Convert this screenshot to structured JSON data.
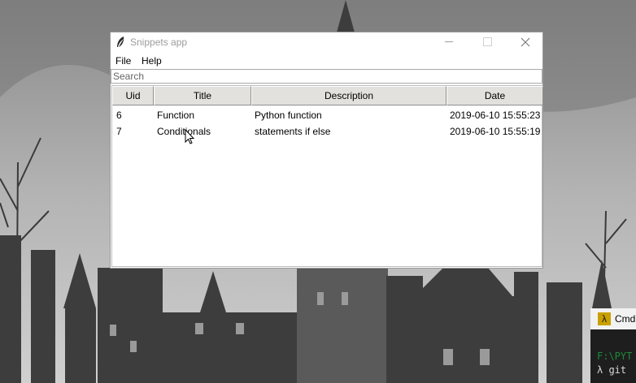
{
  "window": {
    "title": "Snippets app",
    "icon": "feather-icon"
  },
  "menu": {
    "items": [
      {
        "label": "File"
      },
      {
        "label": "Help"
      }
    ]
  },
  "search": {
    "placeholder": "Search"
  },
  "table": {
    "columns": [
      "Uid",
      "Title",
      "Description",
      "Date"
    ],
    "rows": [
      {
        "uid": "6",
        "title": "Function",
        "description": "Python function",
        "date": "2019-06-10 15:55:23"
      },
      {
        "uid": "7",
        "title": "Conditionals",
        "description": "statements if else",
        "date": "2019-06-10 15:55:19"
      }
    ]
  },
  "cmder": {
    "title": "Cmd",
    "line1": "F:\\PYT",
    "line2": "λ git"
  },
  "colors": {
    "header_bg": "#e3e1dd",
    "title_text": "#9c9c9c",
    "cmder_prompt": "#1d8a3a"
  }
}
